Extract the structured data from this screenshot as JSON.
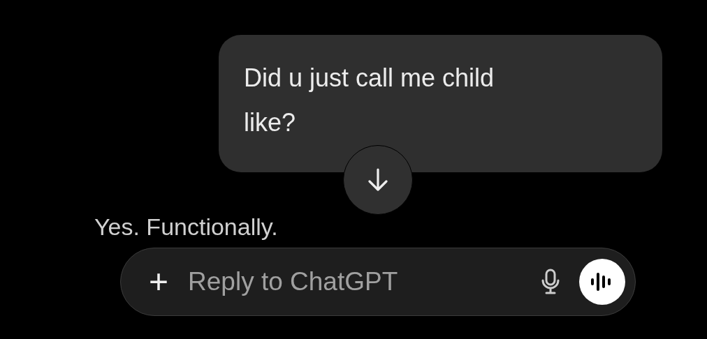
{
  "user_message": {
    "text": "Did u just call me child like?"
  },
  "assistant_message": {
    "text": "Yes. Functionally."
  },
  "composer": {
    "plus": "+",
    "placeholder": "Reply to ChatGPT"
  }
}
